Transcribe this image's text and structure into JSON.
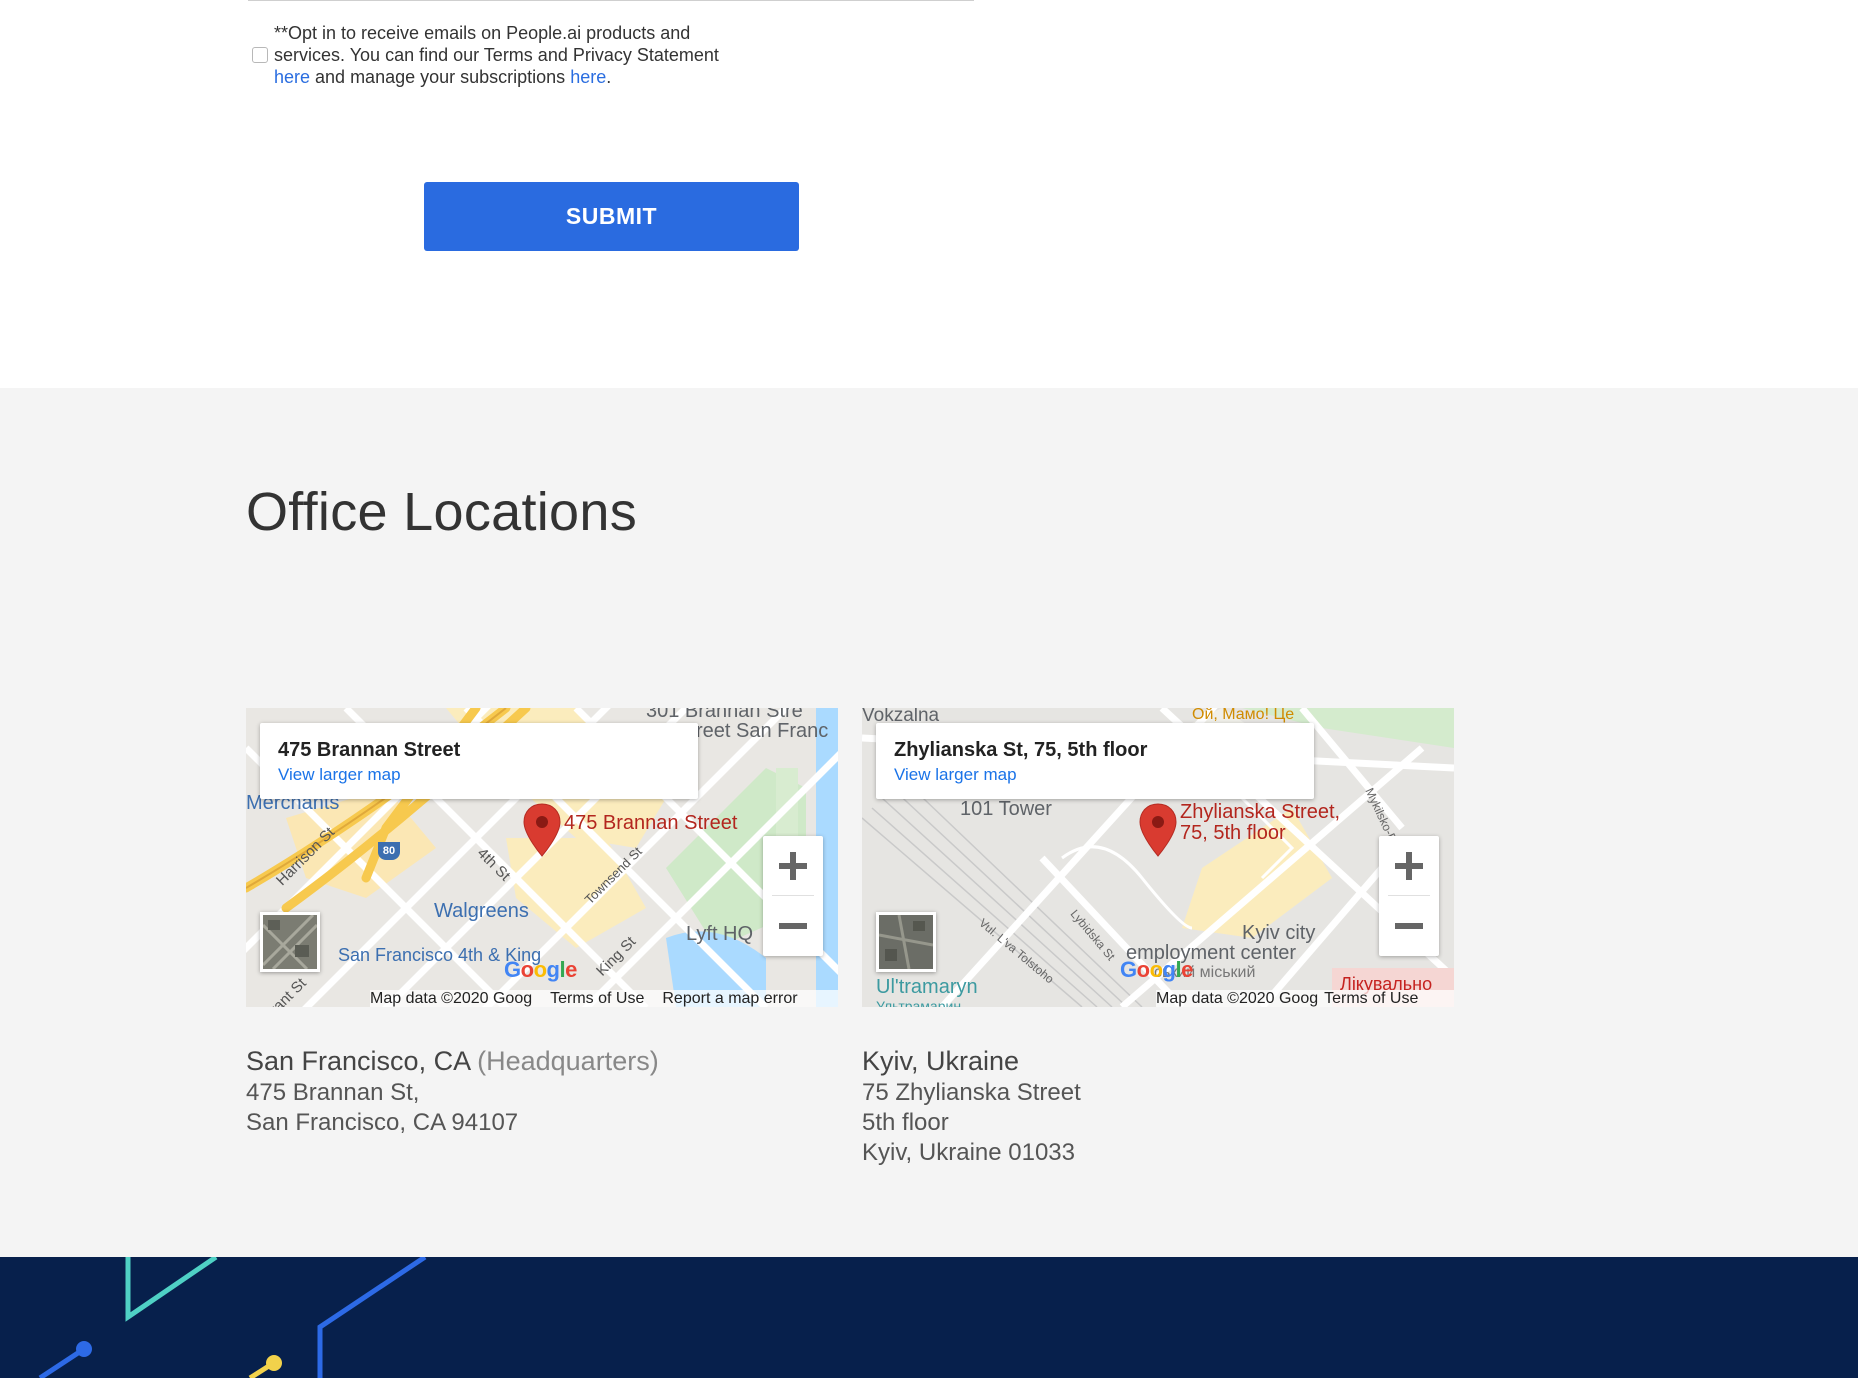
{
  "optin": {
    "text_before": "**Opt in to receive emails on People.ai products and services. You can find our Terms and Privacy Statement ",
    "link1": "here",
    "text_middle": " and manage your subscriptions ",
    "link2": "here",
    "text_after": "."
  },
  "form": {
    "submit_label": "SUBMIT"
  },
  "offices": {
    "title": "Office Locations",
    "items": [
      {
        "map": {
          "card_title": "475 Brannan Street",
          "view_larger": "View larger map",
          "pin_label": "475 Brannan Street",
          "labels": [
            "301 Brannan Stre",
            "reet San Franc",
            "Merchants",
            "Harrison St",
            "4th St",
            "Townsend St",
            "Walgreens",
            "Lyft HQ",
            "San Francisco 4th & King",
            "King St",
            "rant St",
            "80"
          ],
          "attribution": [
            "Map data ©2020 Goog",
            "Terms of Use",
            "Report a map error"
          ]
        },
        "city": "San Francisco, CA",
        "city_note": "(Headquarters)",
        "address_lines": [
          "475 Brannan St,",
          "San Francisco, CA 94107"
        ]
      },
      {
        "map": {
          "card_title": "Zhylianska St, 75, 5th floor",
          "view_larger": "View larger map",
          "pin_label_1": "Zhylianska Street,",
          "pin_label_2": "75, 5th floor",
          "labels": [
            "Vokzalna",
            "Ой, Мамо! Це",
            "101 Tower",
            "Kyiv city",
            "employment center",
            "Ul'tramaryn",
            "Lybidska St",
            "Vul. L'va Tolstoho",
            "Mykilsko-B",
            "Лікувально",
            "ський міський",
            "Ультрамарин"
          ],
          "attribution": [
            "Map data ©2020 Goog",
            "Terms of Use"
          ]
        },
        "city": "Kyiv, Ukraine",
        "city_note": "",
        "address_lines": [
          "75 Zhylianska Street",
          "5th floor",
          "Kyiv, Ukraine 01033"
        ]
      }
    ]
  },
  "colors": {
    "accent": "#2a6be0",
    "link": "#1a73e8",
    "section_bg": "#f4f4f4",
    "footer_bg": "#07204c",
    "pin": "#d93b30"
  },
  "icons": [
    "checkbox-icon",
    "map-pin-icon",
    "zoom-in-icon",
    "zoom-out-icon",
    "satellite-view-icon",
    "google-logo"
  ]
}
